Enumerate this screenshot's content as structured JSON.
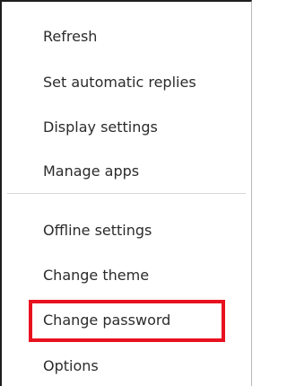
{
  "menu": {
    "items": [
      {
        "label": "Refresh"
      },
      {
        "label": "Set automatic replies"
      },
      {
        "label": "Display settings"
      },
      {
        "label": "Manage apps"
      },
      {
        "label": "Offline settings"
      },
      {
        "label": "Change theme"
      },
      {
        "label": "Change password"
      },
      {
        "label": "Options"
      }
    ]
  },
  "colors": {
    "text": "#2b2b2b",
    "divider": "#d6d6d6",
    "highlight": "#e8111f"
  }
}
